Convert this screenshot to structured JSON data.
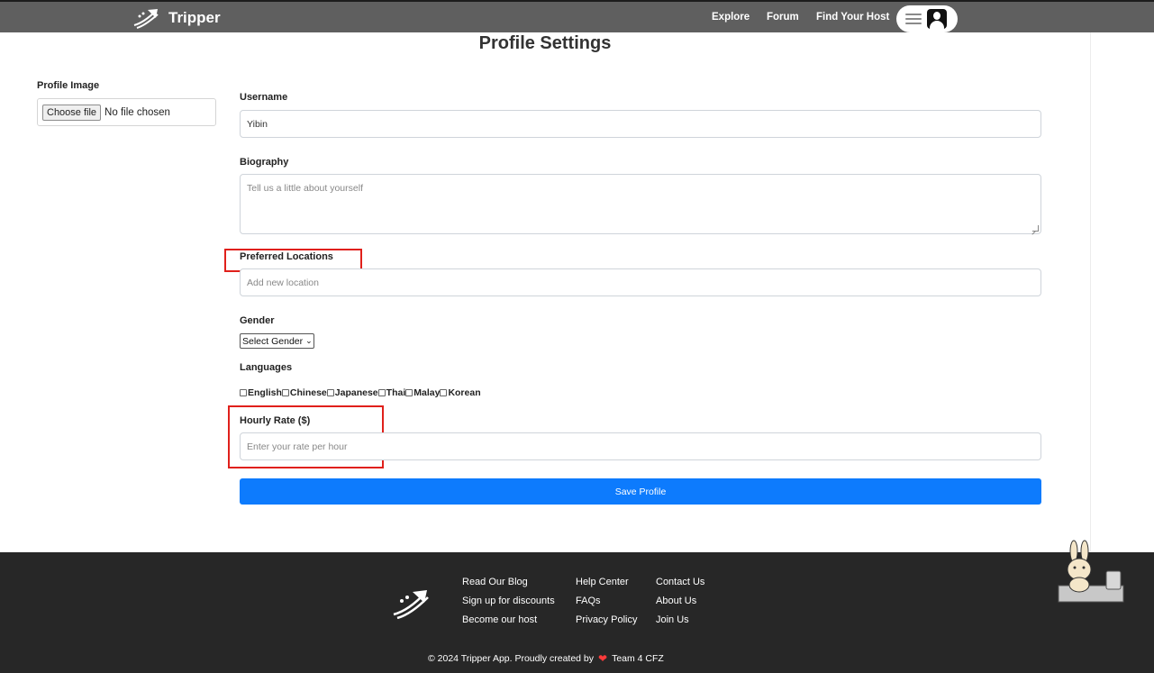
{
  "navbar": {
    "brand": "Tripper",
    "links": [
      "Explore",
      "Forum",
      "Find Your Host"
    ]
  },
  "page": {
    "title": "Profile Settings"
  },
  "profile_image": {
    "label": "Profile Image",
    "button": "Choose file",
    "status": "No file chosen"
  },
  "form": {
    "username_label": "Username",
    "username_value": "Yibin",
    "bio_label": "Biography",
    "bio_placeholder": "Tell us a little about yourself",
    "locations_label": "Preferred Locations",
    "locations_placeholder": "Add new location",
    "gender_label": "Gender",
    "gender_selected": "Select Gender",
    "languages_label": "Languages",
    "languages": [
      "English",
      "Chinese",
      "Japanese",
      "Thai",
      "Malay",
      "Korean"
    ],
    "rate_label": "Hourly Rate ($)",
    "rate_placeholder": "Enter your rate per hour",
    "save_label": "Save Profile"
  },
  "footer": {
    "col1": [
      "Read Our Blog",
      "Sign up for discounts",
      "Become our host"
    ],
    "col2": [
      "Help Center",
      "FAQs",
      "Privacy Policy"
    ],
    "col3": [
      "Contact Us",
      "About Us",
      "Join Us"
    ],
    "copyright_prefix": "© 2024 Tripper App. Proudly created by",
    "copyright_suffix": "Team 4 CFZ"
  },
  "colors": {
    "navbar": "#5f5f5f",
    "footer": "#272727",
    "primary": "#0d7bfd",
    "highlight": "#e0201b"
  },
  "icons": [
    "logo-icon",
    "hamburger-icon",
    "user-icon",
    "heart-icon",
    "mascot-image"
  ]
}
